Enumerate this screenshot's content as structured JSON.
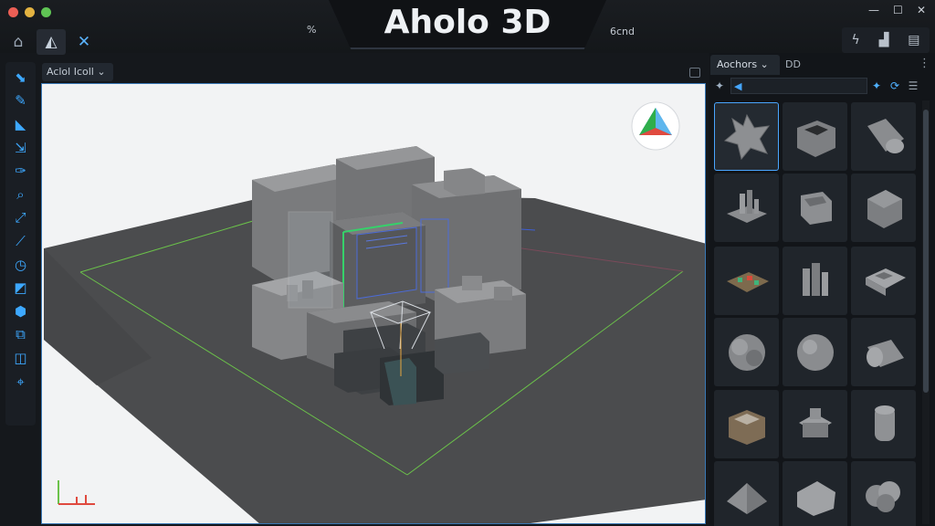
{
  "window": {
    "title": "Aholo 3D",
    "left_label": "%",
    "right_label": "6cnd"
  },
  "toolbar_top": {
    "items": [
      {
        "icon": "home-icon",
        "glyph": "⌂"
      },
      {
        "icon": "shape-icon",
        "glyph": "◭"
      },
      {
        "icon": "transform-icon",
        "glyph": "✕"
      }
    ],
    "right_tools": [
      {
        "icon": "lightning-icon",
        "glyph": "ϟ"
      },
      {
        "icon": "camera-icon",
        "glyph": "▟"
      },
      {
        "icon": "save-icon",
        "glyph": "▤"
      }
    ]
  },
  "left_tools": {
    "items": [
      {
        "icon": "select-icon",
        "glyph": "⬊"
      },
      {
        "icon": "brush-icon",
        "glyph": "✎"
      },
      {
        "icon": "eraser-icon",
        "glyph": "◣"
      },
      {
        "icon": "transform-icon",
        "glyph": "⇲"
      },
      {
        "icon": "pen-icon",
        "glyph": "✑"
      },
      {
        "icon": "zoom-icon",
        "glyph": "⌕"
      },
      {
        "icon": "scale-icon",
        "glyph": "⤢"
      },
      {
        "icon": "knife-icon",
        "glyph": "⟋"
      },
      {
        "icon": "clock-icon",
        "glyph": "◷"
      },
      {
        "icon": "layers-icon",
        "glyph": "◩"
      },
      {
        "icon": "cube-icon",
        "glyph": "⬢"
      },
      {
        "icon": "duplicate-icon",
        "glyph": "⧉"
      },
      {
        "icon": "folder-icon",
        "glyph": "◫"
      },
      {
        "icon": "align-icon",
        "glyph": "⌖"
      }
    ]
  },
  "viewport": {
    "dropdown_label": "Aclol Icoll ⌄"
  },
  "right_panel": {
    "tab_label": "Aochors ⌄",
    "tab2_label": "DD",
    "assets": [
      {
        "name": "spiky-blob-asset",
        "selected": true
      },
      {
        "name": "hollow-box-asset"
      },
      {
        "name": "cylinder-asset"
      },
      {
        "name": "city-block-asset"
      },
      {
        "name": "open-cube-asset"
      },
      {
        "name": "solid-cube-asset"
      },
      {
        "name": "circuit-board-asset"
      },
      {
        "name": "towers-asset"
      },
      {
        "name": "room-asset"
      },
      {
        "name": "rounded-cube-asset"
      },
      {
        "name": "sphere-asset"
      },
      {
        "name": "capsule-asset"
      },
      {
        "name": "crate-asset"
      },
      {
        "name": "machine-asset"
      },
      {
        "name": "tube-asset"
      },
      {
        "name": "tent-asset"
      },
      {
        "name": "pillow-asset"
      },
      {
        "name": "blob-asset"
      }
    ]
  },
  "colors": {
    "accent": "#3da8ff",
    "viewport_border": "#3a78b5",
    "ground": "#4a4b4d",
    "green_line": "#6bc24a",
    "blue_line": "#3e5fd6"
  }
}
